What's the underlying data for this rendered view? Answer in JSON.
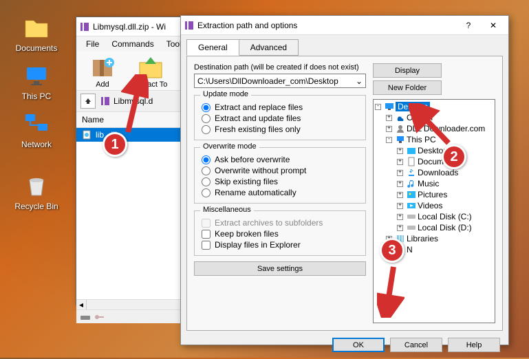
{
  "desktop": {
    "icons": [
      {
        "name": "documents",
        "label": "Documents"
      },
      {
        "name": "this-pc",
        "label": "This PC"
      },
      {
        "name": "network",
        "label": "Network"
      },
      {
        "name": "recycle-bin",
        "label": "Recycle Bin"
      }
    ]
  },
  "winrar": {
    "title": "Libmysql.dll.zip - Wi",
    "menu": [
      "File",
      "Commands",
      "Tools"
    ],
    "toolbar": [
      {
        "name": "add",
        "label": "Add"
      },
      {
        "name": "extract-to",
        "label": "Extract To"
      }
    ],
    "address": "Libmysql.d",
    "list": {
      "header": "Name",
      "rows": [
        {
          "name": "lib              .dll",
          "selected": true
        }
      ]
    }
  },
  "dialog": {
    "title": "Extraction path and options",
    "help_glyph": "?",
    "close_glyph": "✕",
    "tabs": [
      "General",
      "Advanced"
    ],
    "dest_label": "Destination path (will be created if does not exist)",
    "dest_value": "C:\\Users\\DllDownloader_com\\Desktop",
    "display_btn": "Display",
    "newfolder_btn": "New Folder",
    "update_mode": {
      "label": "Update mode",
      "options": [
        "Extract and replace files",
        "Extract and update files",
        "Fresh existing files only"
      ],
      "selected": 0
    },
    "overwrite_mode": {
      "label": "Overwrite mode",
      "options": [
        "Ask before overwrite",
        "Overwrite without prompt",
        "Skip existing files",
        "Rename automatically"
      ],
      "selected": 0
    },
    "misc": {
      "label": "Miscellaneous",
      "options": [
        "Extract archives to subfolders",
        "Keep broken files",
        "Display files in Explorer"
      ],
      "disabled": [
        true,
        false,
        false
      ]
    },
    "save_settings": "Save settings",
    "tree": [
      {
        "depth": 0,
        "exp": "-",
        "icon": "desktop",
        "label": "Desktop",
        "selected": true
      },
      {
        "depth": 1,
        "exp": "+",
        "icon": "onedrive",
        "label": "OneDri"
      },
      {
        "depth": 1,
        "exp": "+",
        "icon": "user",
        "label": "DLL Downloader.com"
      },
      {
        "depth": 1,
        "exp": "-",
        "icon": "pc",
        "label": "This PC"
      },
      {
        "depth": 2,
        "exp": "+",
        "icon": "desktop-folder",
        "label": "Desktop"
      },
      {
        "depth": 2,
        "exp": "+",
        "icon": "documents",
        "label": "Document"
      },
      {
        "depth": 2,
        "exp": "+",
        "icon": "downloads",
        "label": "Downloads"
      },
      {
        "depth": 2,
        "exp": "+",
        "icon": "music",
        "label": "Music"
      },
      {
        "depth": 2,
        "exp": "+",
        "icon": "pictures",
        "label": "Pictures"
      },
      {
        "depth": 2,
        "exp": "+",
        "icon": "videos",
        "label": "Videos"
      },
      {
        "depth": 2,
        "exp": "+",
        "icon": "disk",
        "label": "Local Disk (C:)"
      },
      {
        "depth": 2,
        "exp": "+",
        "icon": "disk",
        "label": "Local Disk (D:)"
      },
      {
        "depth": 1,
        "exp": "+",
        "icon": "libraries",
        "label": "Libraries"
      },
      {
        "depth": 1,
        "exp": "+",
        "icon": "network",
        "label": "N"
      }
    ],
    "buttons": {
      "ok": "OK",
      "cancel": "Cancel",
      "help": "Help"
    }
  },
  "annotations": {
    "circle1": "1",
    "circle2": "2",
    "circle3": "3"
  }
}
